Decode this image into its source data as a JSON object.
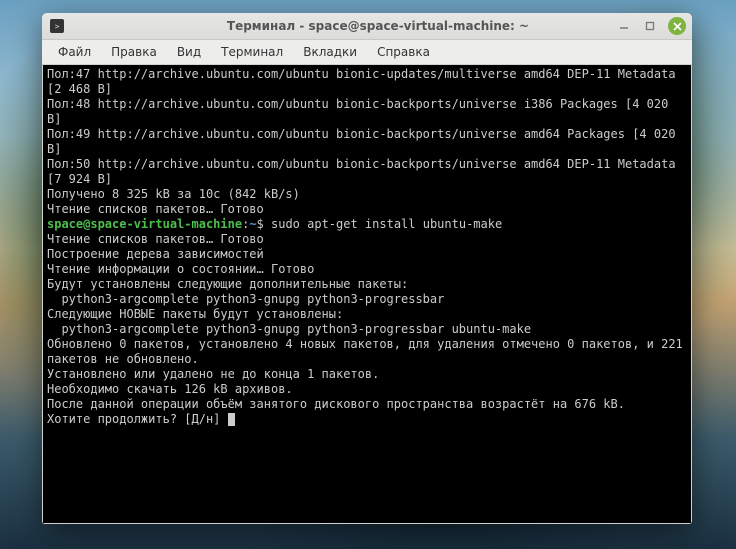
{
  "window": {
    "title": "Терминал - space@space-virtual-machine: ~"
  },
  "menubar": {
    "items": [
      "Файл",
      "Правка",
      "Вид",
      "Терминал",
      "Вкладки",
      "Справка"
    ]
  },
  "prompt": {
    "user_host": "space@space-virtual-machine",
    "sep": ":",
    "path": "~",
    "dollar": "$ ",
    "command": "sudo apt-get install ubuntu-make"
  },
  "terminal_lines_before": [
    "Пол:47 http://archive.ubuntu.com/ubuntu bionic-updates/multiverse amd64 DEP-11 Metadata [2 468 B]",
    "Пол:48 http://archive.ubuntu.com/ubuntu bionic-backports/universe i386 Packages [4 020 B]",
    "Пол:49 http://archive.ubuntu.com/ubuntu bionic-backports/universe amd64 Packages [4 020 B]",
    "Пол:50 http://archive.ubuntu.com/ubuntu bionic-backports/universe amd64 DEP-11 Metadata [7 924 B]",
    "Получено 8 325 kB за 10с (842 kB/s)",
    "Чтение списков пакетов… Готово"
  ],
  "terminal_lines_after": [
    "Чтение списков пакетов… Готово",
    "Построение дерева зависимостей",
    "Чтение информации о состоянии… Готово",
    "Будут установлены следующие дополнительные пакеты:",
    "  python3-argcomplete python3-gnupg python3-progressbar",
    "Следующие НОВЫЕ пакеты будут установлены:",
    "  python3-argcomplete python3-gnupg python3-progressbar ubuntu-make",
    "Обновлено 0 пакетов, установлено 4 новых пакетов, для удаления отмечено 0 пакетов, и 221 пакетов не обновлено.",
    "Установлено или удалено не до конца 1 пакетов.",
    "Необходимо скачать 126 kB архивов.",
    "После данной операции объём занятого дискового пространства возрастёт на 676 kB.",
    "Хотите продолжить? [Д/н] "
  ]
}
